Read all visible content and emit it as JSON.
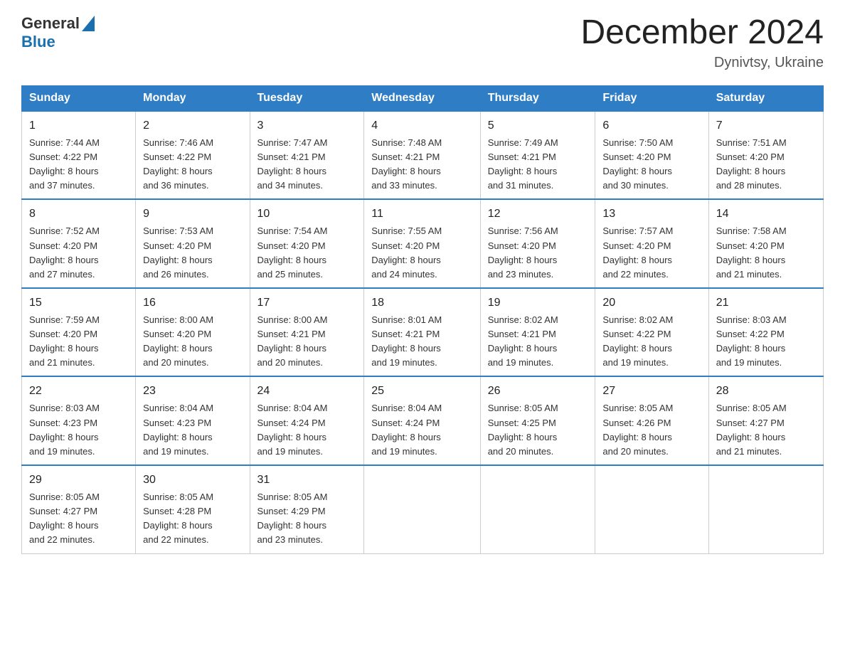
{
  "header": {
    "logo_general": "General",
    "logo_blue": "Blue",
    "month_title": "December 2024",
    "location": "Dynivtsy, Ukraine"
  },
  "weekdays": [
    "Sunday",
    "Monday",
    "Tuesday",
    "Wednesday",
    "Thursday",
    "Friday",
    "Saturday"
  ],
  "weeks": [
    [
      {
        "day": "1",
        "sunrise": "7:44 AM",
        "sunset": "4:22 PM",
        "daylight": "8 hours and 37 minutes."
      },
      {
        "day": "2",
        "sunrise": "7:46 AM",
        "sunset": "4:22 PM",
        "daylight": "8 hours and 36 minutes."
      },
      {
        "day": "3",
        "sunrise": "7:47 AM",
        "sunset": "4:21 PM",
        "daylight": "8 hours and 34 minutes."
      },
      {
        "day": "4",
        "sunrise": "7:48 AM",
        "sunset": "4:21 PM",
        "daylight": "8 hours and 33 minutes."
      },
      {
        "day": "5",
        "sunrise": "7:49 AM",
        "sunset": "4:21 PM",
        "daylight": "8 hours and 31 minutes."
      },
      {
        "day": "6",
        "sunrise": "7:50 AM",
        "sunset": "4:20 PM",
        "daylight": "8 hours and 30 minutes."
      },
      {
        "day": "7",
        "sunrise": "7:51 AM",
        "sunset": "4:20 PM",
        "daylight": "8 hours and 28 minutes."
      }
    ],
    [
      {
        "day": "8",
        "sunrise": "7:52 AM",
        "sunset": "4:20 PM",
        "daylight": "8 hours and 27 minutes."
      },
      {
        "day": "9",
        "sunrise": "7:53 AM",
        "sunset": "4:20 PM",
        "daylight": "8 hours and 26 minutes."
      },
      {
        "day": "10",
        "sunrise": "7:54 AM",
        "sunset": "4:20 PM",
        "daylight": "8 hours and 25 minutes."
      },
      {
        "day": "11",
        "sunrise": "7:55 AM",
        "sunset": "4:20 PM",
        "daylight": "8 hours and 24 minutes."
      },
      {
        "day": "12",
        "sunrise": "7:56 AM",
        "sunset": "4:20 PM",
        "daylight": "8 hours and 23 minutes."
      },
      {
        "day": "13",
        "sunrise": "7:57 AM",
        "sunset": "4:20 PM",
        "daylight": "8 hours and 22 minutes."
      },
      {
        "day": "14",
        "sunrise": "7:58 AM",
        "sunset": "4:20 PM",
        "daylight": "8 hours and 21 minutes."
      }
    ],
    [
      {
        "day": "15",
        "sunrise": "7:59 AM",
        "sunset": "4:20 PM",
        "daylight": "8 hours and 21 minutes."
      },
      {
        "day": "16",
        "sunrise": "8:00 AM",
        "sunset": "4:20 PM",
        "daylight": "8 hours and 20 minutes."
      },
      {
        "day": "17",
        "sunrise": "8:00 AM",
        "sunset": "4:21 PM",
        "daylight": "8 hours and 20 minutes."
      },
      {
        "day": "18",
        "sunrise": "8:01 AM",
        "sunset": "4:21 PM",
        "daylight": "8 hours and 19 minutes."
      },
      {
        "day": "19",
        "sunrise": "8:02 AM",
        "sunset": "4:21 PM",
        "daylight": "8 hours and 19 minutes."
      },
      {
        "day": "20",
        "sunrise": "8:02 AM",
        "sunset": "4:22 PM",
        "daylight": "8 hours and 19 minutes."
      },
      {
        "day": "21",
        "sunrise": "8:03 AM",
        "sunset": "4:22 PM",
        "daylight": "8 hours and 19 minutes."
      }
    ],
    [
      {
        "day": "22",
        "sunrise": "8:03 AM",
        "sunset": "4:23 PM",
        "daylight": "8 hours and 19 minutes."
      },
      {
        "day": "23",
        "sunrise": "8:04 AM",
        "sunset": "4:23 PM",
        "daylight": "8 hours and 19 minutes."
      },
      {
        "day": "24",
        "sunrise": "8:04 AM",
        "sunset": "4:24 PM",
        "daylight": "8 hours and 19 minutes."
      },
      {
        "day": "25",
        "sunrise": "8:04 AM",
        "sunset": "4:24 PM",
        "daylight": "8 hours and 19 minutes."
      },
      {
        "day": "26",
        "sunrise": "8:05 AM",
        "sunset": "4:25 PM",
        "daylight": "8 hours and 20 minutes."
      },
      {
        "day": "27",
        "sunrise": "8:05 AM",
        "sunset": "4:26 PM",
        "daylight": "8 hours and 20 minutes."
      },
      {
        "day": "28",
        "sunrise": "8:05 AM",
        "sunset": "4:27 PM",
        "daylight": "8 hours and 21 minutes."
      }
    ],
    [
      {
        "day": "29",
        "sunrise": "8:05 AM",
        "sunset": "4:27 PM",
        "daylight": "8 hours and 22 minutes."
      },
      {
        "day": "30",
        "sunrise": "8:05 AM",
        "sunset": "4:28 PM",
        "daylight": "8 hours and 22 minutes."
      },
      {
        "day": "31",
        "sunrise": "8:05 AM",
        "sunset": "4:29 PM",
        "daylight": "8 hours and 23 minutes."
      },
      null,
      null,
      null,
      null
    ]
  ],
  "labels": {
    "sunrise": "Sunrise:",
    "sunset": "Sunset:",
    "daylight": "Daylight:"
  }
}
